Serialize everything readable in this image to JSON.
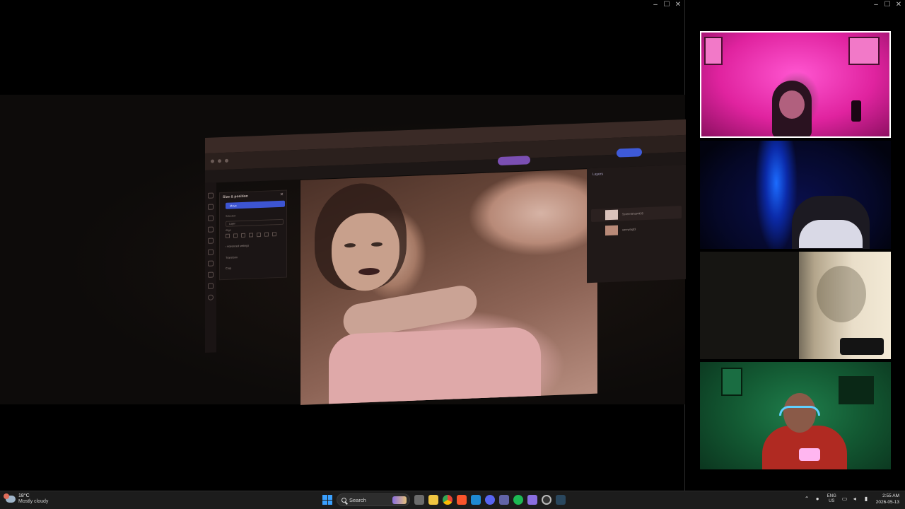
{
  "windows": {
    "controls": [
      "–",
      "☐",
      "✕"
    ]
  },
  "editor": {
    "panel_title": "Size & position",
    "panel_close": "✕",
    "move_label": "Move",
    "selection_label": "Selection",
    "select_value": "Layer",
    "align_label": "Align",
    "advanced_label": "› Advanced settings",
    "transform_label": "Transform",
    "crop_label": "Crop",
    "layers_title": "Layers",
    "layer_items": [
      "ScreenShot4435",
      "sonnylagf3"
    ]
  },
  "taskbar": {
    "weather_temp": "18°C",
    "weather_cond": "Mostly cloudy",
    "search_placeholder": "Search",
    "lang_top": "ENG",
    "lang_bottom": "US",
    "time": "2:55 AM",
    "date": "2026-05-13",
    "icons": [
      "file-explorer-icon",
      "chrome-icon",
      "brave-icon",
      "vscode-icon",
      "discord-icon",
      "teams-icon",
      "spotify-icon",
      "app-icon",
      "obs-icon",
      "steam-icon"
    ]
  },
  "colors": {
    "accent_blue": "#3d55d2",
    "upgrade_purple": "#7b4fb3",
    "active_tile_border": "#ffffff"
  }
}
